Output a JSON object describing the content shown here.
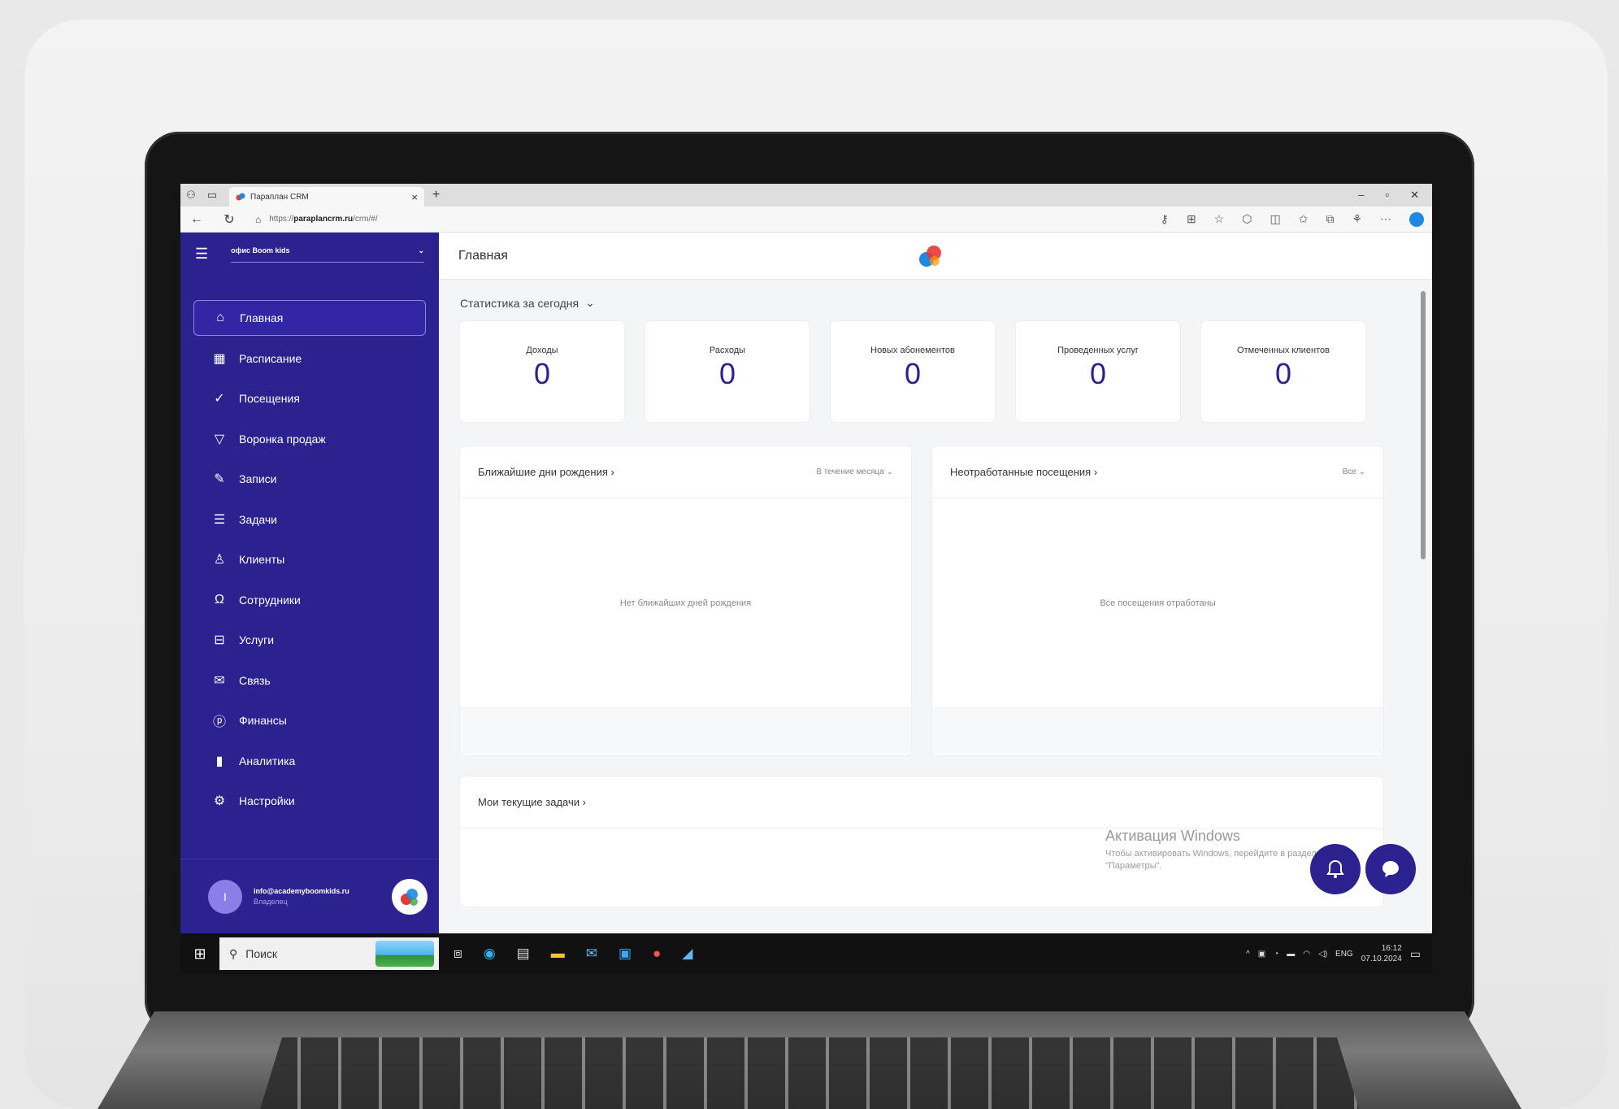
{
  "browser": {
    "tab_title": "Параплан CRM",
    "tab_close": "×",
    "new_tab": "+",
    "url_prefix": "https://",
    "url_host": "paraplancrm.ru",
    "url_path": "/crm/#/",
    "win_controls": [
      "–",
      "▫",
      "✕"
    ],
    "toolbar_icons": [
      "key-icon",
      "grid-icon",
      "star-icon",
      "extension-icon",
      "split-icon",
      "favorites-icon",
      "collections-icon",
      "profile-icon",
      "more-icon",
      "edge-icon"
    ]
  },
  "sidebar": {
    "org_name": "офис Boom kids",
    "items": [
      {
        "label": "Главная",
        "icon": "⌂",
        "icon_name": "home-icon",
        "active": true
      },
      {
        "label": "Расписание",
        "icon": "▦",
        "icon_name": "calendar-icon"
      },
      {
        "label": "Посещения",
        "icon": "✓",
        "icon_name": "check-icon"
      },
      {
        "label": "Воронка продаж",
        "icon": "▽",
        "icon_name": "funnel-icon"
      },
      {
        "label": "Записи",
        "icon": "✎",
        "icon_name": "note-icon"
      },
      {
        "label": "Задачи",
        "icon": "☰",
        "icon_name": "tasks-icon"
      },
      {
        "label": "Клиенты",
        "icon": "♙",
        "icon_name": "client-icon"
      },
      {
        "label": "Сотрудники",
        "icon": "Ω",
        "icon_name": "staff-icon"
      },
      {
        "label": "Услуги",
        "icon": "⊟",
        "icon_name": "services-icon"
      },
      {
        "label": "Связь",
        "icon": "✉",
        "icon_name": "mail-icon"
      },
      {
        "label": "Финансы",
        "icon": "ⓟ",
        "icon_name": "finance-icon"
      },
      {
        "label": "Аналитика",
        "icon": "▮",
        "icon_name": "analytics-icon"
      },
      {
        "label": "Настройки",
        "icon": "⚙",
        "icon_name": "settings-icon"
      }
    ],
    "user_email": "info@academyboomkids.ru",
    "user_role": "Владелец",
    "user_initial": "I"
  },
  "main": {
    "page_title": "Главная",
    "stats_title": "Статистика за сегодня",
    "stats": [
      {
        "label": "Доходы",
        "value": "0"
      },
      {
        "label": "Расходы",
        "value": "0"
      },
      {
        "label": "Новых абонементов",
        "value": "0"
      },
      {
        "label": "Проведенных услуг",
        "value": "0"
      },
      {
        "label": "Отмеченных клиентов",
        "value": "0"
      }
    ],
    "birthdays": {
      "title": "Ближайшие дни рождения",
      "filter": "В течение месяца",
      "empty": "Нет ближайших дней рождения"
    },
    "unprocessed": {
      "title": "Неотработанные посещения",
      "filter": "Все",
      "empty": "Все посещения отработаны"
    },
    "tasks": {
      "title": "Мои текущие задачи"
    }
  },
  "watermark": {
    "title": "Активация Windows",
    "text": "Чтобы активировать Windows, перейдите в раздел \"Параметры\"."
  },
  "taskbar": {
    "search_placeholder": "Поиск",
    "lang": "ENG",
    "time": "16:12",
    "date": "07.10.2024"
  },
  "colors": {
    "sidebar": "#2b2290",
    "accent": "#2b2290",
    "background": "#f4f5f7"
  }
}
